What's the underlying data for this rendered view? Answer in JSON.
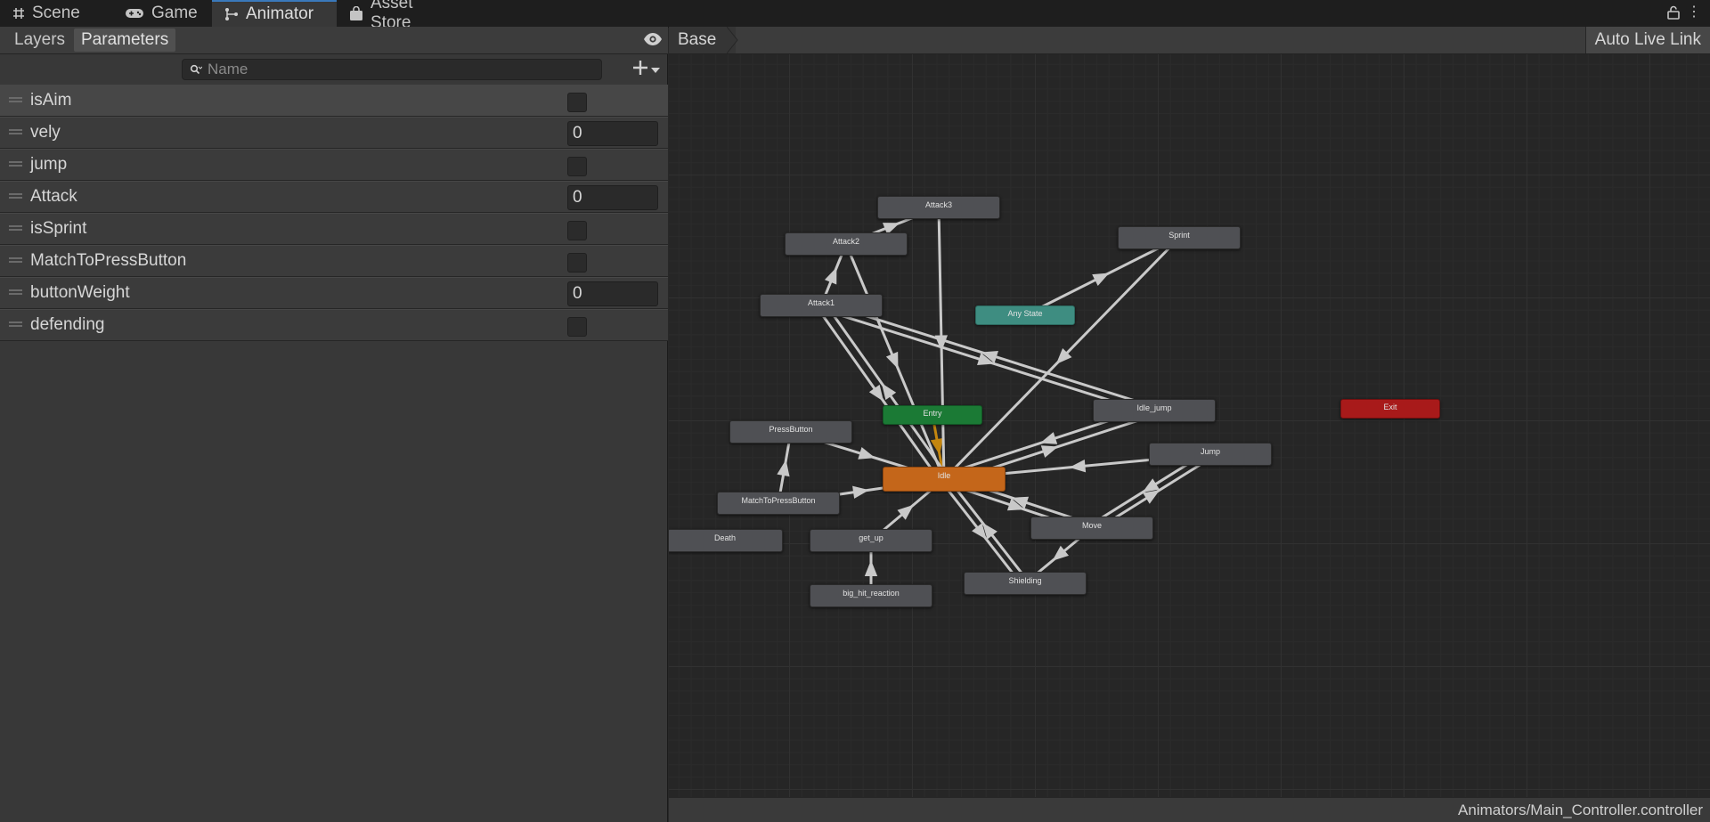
{
  "tabs": [
    {
      "label": "Scene",
      "icon": "grid-icon",
      "active": false
    },
    {
      "label": "Game",
      "icon": "gamepad-icon",
      "active": false
    },
    {
      "label": "Animator",
      "icon": "animator-icon",
      "active": true
    },
    {
      "label": "Asset Store",
      "icon": "bag-icon",
      "active": false
    }
  ],
  "left_panel": {
    "subtabs": [
      {
        "label": "Layers",
        "active": false
      },
      {
        "label": "Parameters",
        "active": true
      }
    ],
    "search": {
      "placeholder": "Name",
      "value": ""
    },
    "parameters": [
      {
        "name": "isAim",
        "type": "bool",
        "value": false,
        "selected": true
      },
      {
        "name": "vely",
        "type": "number",
        "value": "0"
      },
      {
        "name": "jump",
        "type": "bool",
        "value": false
      },
      {
        "name": "Attack",
        "type": "number",
        "value": "0"
      },
      {
        "name": "isSprint",
        "type": "bool",
        "value": false
      },
      {
        "name": "MatchToPressButton",
        "type": "bool",
        "value": false
      },
      {
        "name": "buttonWeight",
        "type": "number",
        "value": "0"
      },
      {
        "name": "defending",
        "type": "bool",
        "value": false
      }
    ]
  },
  "graph": {
    "breadcrumb": "Base",
    "auto_live_link_label": "Auto Live Link",
    "states": [
      {
        "key": "attack3",
        "label": "Attack3",
        "kind": "normal"
      },
      {
        "key": "attack2",
        "label": "Attack2",
        "kind": "normal"
      },
      {
        "key": "attack1",
        "label": "Attack1",
        "kind": "normal"
      },
      {
        "key": "sprint",
        "label": "Sprint",
        "kind": "normal"
      },
      {
        "key": "any",
        "label": "Any State",
        "kind": "any"
      },
      {
        "key": "entry",
        "label": "Entry",
        "kind": "entry"
      },
      {
        "key": "idle_jump",
        "label": "Idle_jump",
        "kind": "normal"
      },
      {
        "key": "exit",
        "label": "Exit",
        "kind": "exit"
      },
      {
        "key": "pressbutton",
        "label": "PressButton",
        "kind": "normal"
      },
      {
        "key": "jump",
        "label": "Jump",
        "kind": "normal"
      },
      {
        "key": "idle",
        "label": "Idle",
        "kind": "default"
      },
      {
        "key": "matchtopress",
        "label": "MatchToPressButton",
        "kind": "normal"
      },
      {
        "key": "death",
        "label": "Death",
        "kind": "normal"
      },
      {
        "key": "get_up",
        "label": "get_up",
        "kind": "normal"
      },
      {
        "key": "move",
        "label": "Move",
        "kind": "normal"
      },
      {
        "key": "shielding",
        "label": "Shielding",
        "kind": "normal"
      },
      {
        "key": "big_hit",
        "label": "big_hit_reaction",
        "kind": "normal"
      }
    ],
    "colors": {
      "normal": "#4f5054",
      "default": "#c4661a",
      "entry": "#1b7a35",
      "any": "#3e8d81",
      "exit": "#a81a1a",
      "transition": "#c9c9c9",
      "entry_transition": "#c4860f"
    }
  },
  "status_bar": {
    "controller_path": "Animators/Main_Controller.controller"
  }
}
